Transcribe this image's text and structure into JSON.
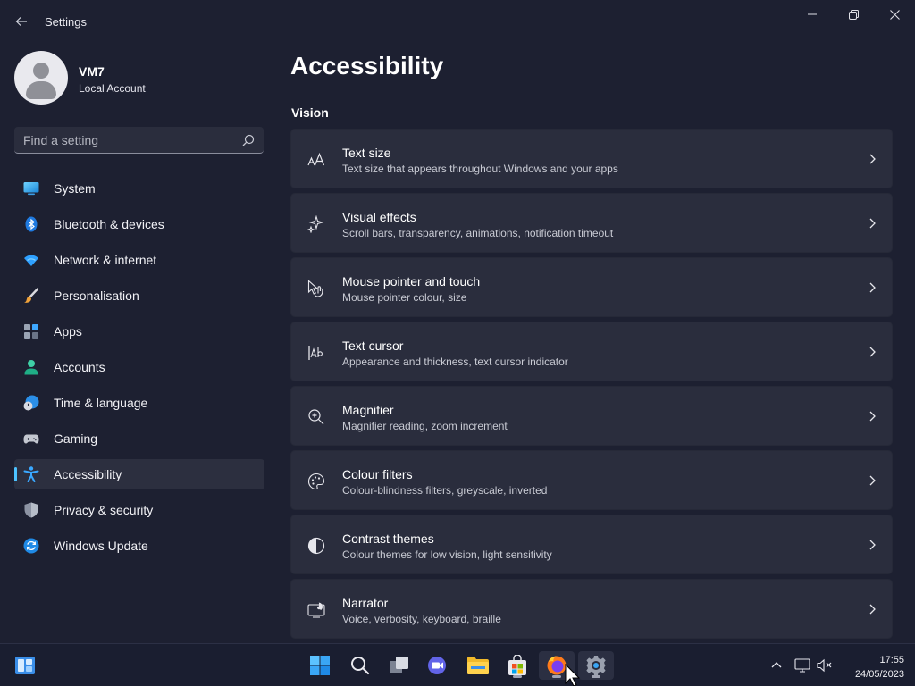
{
  "window": {
    "title": "Settings"
  },
  "profile": {
    "name": "VM7",
    "account_type": "Local Account"
  },
  "search": {
    "placeholder": "Find a setting",
    "value": ""
  },
  "nav": {
    "items": [
      {
        "label": "System",
        "icon": "monitor-icon",
        "active": false
      },
      {
        "label": "Bluetooth & devices",
        "icon": "bluetooth-icon",
        "active": false
      },
      {
        "label": "Network & internet",
        "icon": "wifi-icon",
        "active": false
      },
      {
        "label": "Personalisation",
        "icon": "brush-icon",
        "active": false
      },
      {
        "label": "Apps",
        "icon": "apps-icon",
        "active": false
      },
      {
        "label": "Accounts",
        "icon": "person-icon",
        "active": false
      },
      {
        "label": "Time & language",
        "icon": "globe-clock-icon",
        "active": false
      },
      {
        "label": "Gaming",
        "icon": "gamepad-icon",
        "active": false
      },
      {
        "label": "Accessibility",
        "icon": "accessibility-icon",
        "active": true
      },
      {
        "label": "Privacy & security",
        "icon": "shield-icon",
        "active": false
      },
      {
        "label": "Windows Update",
        "icon": "update-icon",
        "active": false
      }
    ]
  },
  "main": {
    "title": "Accessibility",
    "section": "Vision",
    "cards": [
      {
        "title": "Text size",
        "subtitle": "Text size that appears throughout Windows and your apps",
        "icon": "text-size-icon"
      },
      {
        "title": "Visual effects",
        "subtitle": "Scroll bars, transparency, animations, notification timeout",
        "icon": "sparkle-icon"
      },
      {
        "title": "Mouse pointer and touch",
        "subtitle": "Mouse pointer colour, size",
        "icon": "pointer-touch-icon"
      },
      {
        "title": "Text cursor",
        "subtitle": "Appearance and thickness, text cursor indicator",
        "icon": "text-cursor-icon"
      },
      {
        "title": "Magnifier",
        "subtitle": "Magnifier reading, zoom increment",
        "icon": "magnifier-icon"
      },
      {
        "title": "Colour filters",
        "subtitle": "Colour-blindness filters, greyscale, inverted",
        "icon": "palette-icon"
      },
      {
        "title": "Contrast themes",
        "subtitle": "Colour themes for low vision, light sensitivity",
        "icon": "contrast-icon"
      },
      {
        "title": "Narrator",
        "subtitle": "Voice, verbosity, keyboard, braille",
        "icon": "narrator-icon"
      }
    ]
  },
  "taskbar": {
    "time": "17:55",
    "date": "24/05/2023"
  },
  "colors": {
    "accent": "#4cc2ff",
    "window_bg": "#1d2031",
    "card_bg": "#2a2d3d",
    "taskbar_bg": "#1a1e30"
  }
}
